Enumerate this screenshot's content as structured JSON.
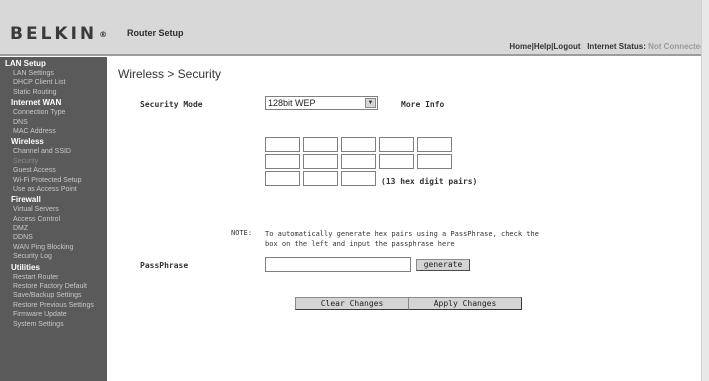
{
  "header": {
    "logo": "BELKIN",
    "logo_mark": "®",
    "router_setup": "Router Setup",
    "home": "Home",
    "help": "Help",
    "logout": "Logout",
    "sep": "|",
    "internet_status_label": "Internet Status:",
    "internet_status_value": "Not Connected"
  },
  "sidebar": {
    "lan_setup": {
      "title": "LAN Setup",
      "items": [
        "LAN Settings",
        "DHCP Client List",
        "Static Routing"
      ]
    },
    "internet_wan": {
      "title": "Internet WAN",
      "items": [
        "Connection Type",
        "DNS",
        "MAC Address"
      ]
    },
    "wireless": {
      "title": "Wireless",
      "items": [
        "Channel and SSID",
        "Security",
        "Guest Access",
        "Wi-Fi Protected Setup",
        "Use as Access Point"
      ]
    },
    "firewall": {
      "title": "Firewall",
      "items": [
        "Virtual Servers",
        "Access Control",
        "DMZ",
        "DDNS",
        "WAN Ping Blocking",
        "Security Log"
      ]
    },
    "utilities": {
      "title": "Utilities",
      "items": [
        "Restart Router",
        "Restore Factory Default",
        "Save/Backup Settings",
        "Restore Previous Settings",
        "Firmware Update",
        "System Settings"
      ]
    },
    "active_item": "Security"
  },
  "main": {
    "page_title": "Wireless > Security",
    "security_mode_label": "Security Mode",
    "security_mode_value": "128bit WEP",
    "more_info": "More Info",
    "hex_hint": "(13 hex digit pairs)",
    "note_label": "NOTE:",
    "note_text": "To automatically generate hex pairs using a PassPhrase, check the box on the left and input the passphrase here",
    "passphrase_label": "PassPhrase",
    "passphrase_value": "",
    "generate_label": "generate",
    "clear_label": "Clear Changes",
    "apply_label": "Apply Changes"
  },
  "colors": {
    "header_bg": "#d8d8d8",
    "sidebar_bg": "#5a5a5a",
    "button_bg": "#d4d4d4",
    "status_gray": "#9a9a9a"
  }
}
